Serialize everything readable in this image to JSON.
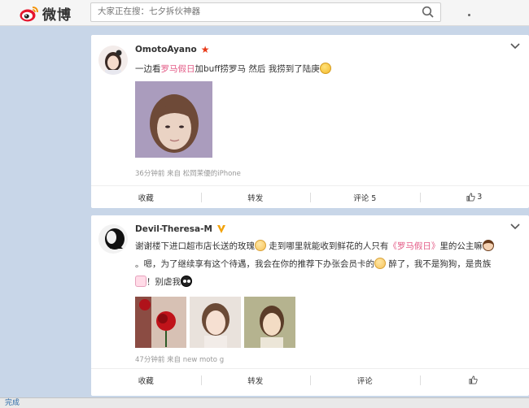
{
  "header": {
    "logo_text": "微博",
    "search_placeholder": "大家正在搜：七夕拆伙神器"
  },
  "posts": [
    {
      "username": "OmotoAyano",
      "text_parts": [
        "一边看",
        "罗马假日",
        "加buff捞罗马 然后 我捞到了陆庚"
      ],
      "meta": "36分钟前 来自 松岡茉優的iPhone",
      "actions": {
        "collect": "收藏",
        "repost": "转发",
        "comment": "评论 5",
        "like": "3"
      }
    },
    {
      "username": "Devil-Theresa-M",
      "line1_parts": [
        "谢谢楼下进口超市店长送的玫瑰",
        " 走到哪里就能收到鲜花的人只有",
        "《罗马假日》",
        "里的公主嘛"
      ],
      "line2_parts": [
        "。嗯，为了继续享有这个待遇，我会在你的推荐下办张会员卡的",
        " 醉了，我不是狗狗，是贵族"
      ],
      "line3_parts": [
        "！别虐我"
      ],
      "meta": "47分钟前 来自 new moto g",
      "actions": {
        "collect": "收藏",
        "repost": "转发",
        "comment": "评论",
        "like": ""
      }
    }
  ],
  "statusbar": {
    "text": "完成"
  },
  "colors": {
    "accent_pink": "#e35b86",
    "star_red": "#e83a18",
    "vip_gold": "#f2a20a",
    "link_blue": "#2a6aa8"
  }
}
